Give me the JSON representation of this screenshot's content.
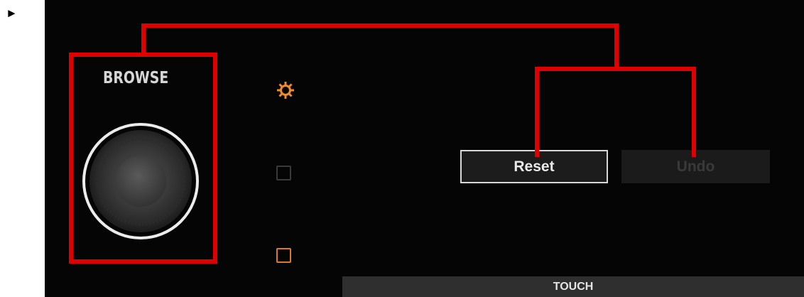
{
  "bullet": "►",
  "browse_section": {
    "label": "BROWSE",
    "encoder_icon": "rotary-encoder-knob"
  },
  "indicators": {
    "settings_icon": "gear-icon",
    "settings_color": "#f08a2c",
    "led_off_color": "#3a3a3a",
    "led_on_color": "#d97a2a"
  },
  "buttons": {
    "reset_label": "Reset",
    "undo_label": "Undo"
  },
  "touch_bar": {
    "label": "TOUCH"
  },
  "callout": {
    "color": "#e00000"
  }
}
